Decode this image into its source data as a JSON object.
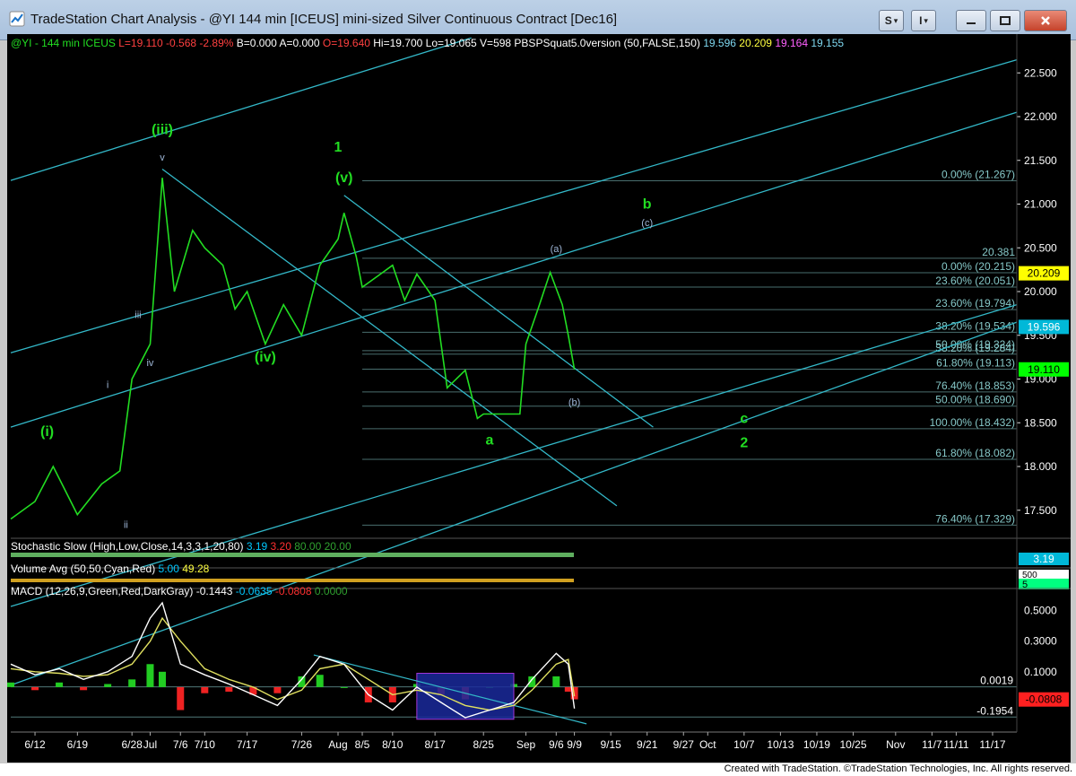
{
  "window": {
    "title": "TradeStation Chart Analysis - @YI 144 min [ICEUS] mini-sized Silver Continuous Contract [Dec16]",
    "btn_s": "S",
    "btn_i": "I",
    "btn_caret": "▾"
  },
  "footer": "Created with TradeStation. ©TradeStation Technologies, Inc. All rights reserved.",
  "colors": {
    "price": "#22dd22",
    "channel": "#33b8c8",
    "fib": "#86c8c8",
    "label_green": "#22dd22",
    "label_blue": "#9fb7d8"
  },
  "chart_data": {
    "type": "line",
    "title": "",
    "info_line": [
      {
        "text": "@YI - 144 min ICEUS",
        "color": "#22dd22"
      },
      {
        "text": "L=19.110 -0.568 -2.89%",
        "color": "#ff4040"
      },
      {
        "text": "B=0.000",
        "color": "#ffffff"
      },
      {
        "text": "A=0.000",
        "color": "#ffffff"
      },
      {
        "text": "O=19.640",
        "color": "#ff4040"
      },
      {
        "text": "Hi=19.700",
        "color": "#ffffff"
      },
      {
        "text": "Lo=19.065",
        "color": "#ffffff"
      },
      {
        "text": "V=598",
        "color": "#ffffff"
      },
      {
        "text": "PBSPSquat5.0version (50,FALSE,150)",
        "color": "#ffffff"
      },
      {
        "text": "19.596",
        "color": "#7fd8f0"
      },
      {
        "text": "20.209",
        "color": "#ffff40"
      },
      {
        "text": "19.164",
        "color": "#ff60ff"
      },
      {
        "text": "19.155",
        "color": "#7fd8f0"
      }
    ],
    "x_ticks": [
      "6/12",
      "6/19",
      "6/28",
      "Jul",
      "7/6",
      "7/10",
      "7/17",
      "7/26",
      "Aug",
      "8/5",
      "8/10",
      "8/17",
      "8/25",
      "Sep",
      "9/6",
      "9/9",
      "9/15",
      "9/21",
      "9/27",
      "Oct",
      "10/7",
      "10/13",
      "10/19",
      "10/25",
      "Nov",
      "11/7",
      "11/11",
      "11/17"
    ],
    "x_tick_dates": [
      "2016-06-12",
      "2016-06-19",
      "2016-06-28",
      "2016-07-01",
      "2016-07-06",
      "2016-07-10",
      "2016-07-17",
      "2016-07-26",
      "2016-08-01",
      "2016-08-05",
      "2016-08-10",
      "2016-08-17",
      "2016-08-25",
      "2016-09-01",
      "2016-09-06",
      "2016-09-09",
      "2016-09-15",
      "2016-09-21",
      "2016-09-27",
      "2016-10-01",
      "2016-10-07",
      "2016-10-13",
      "2016-10-19",
      "2016-10-25",
      "2016-11-01",
      "2016-11-07",
      "2016-11-11",
      "2016-11-17"
    ],
    "price_axis": {
      "range": [
        17.2,
        22.8
      ],
      "ticks": [
        "22.500",
        "22.000",
        "21.500",
        "21.000",
        "20.500",
        "20.000",
        "19.500",
        "19.000",
        "18.500",
        "18.000",
        "17.500"
      ]
    },
    "price_series": {
      "x": [
        "2016-06-08",
        "2016-06-12",
        "2016-06-15",
        "2016-06-19",
        "2016-06-23",
        "2016-06-26",
        "2016-06-28",
        "2016-07-01",
        "2016-07-03",
        "2016-07-05",
        "2016-07-08",
        "2016-07-10",
        "2016-07-13",
        "2016-07-15",
        "2016-07-17",
        "2016-07-20",
        "2016-07-23",
        "2016-07-26",
        "2016-07-29",
        "2016-08-01",
        "2016-08-02",
        "2016-08-04",
        "2016-08-05",
        "2016-08-08",
        "2016-08-10",
        "2016-08-12",
        "2016-08-14",
        "2016-08-17",
        "2016-08-19",
        "2016-08-22",
        "2016-08-24",
        "2016-08-25",
        "2016-08-28",
        "2016-08-31",
        "2016-09-01",
        "2016-09-03",
        "2016-09-05",
        "2016-09-07",
        "2016-09-08",
        "2016-09-09"
      ],
      "y": [
        17.4,
        17.6,
        18.0,
        17.45,
        17.8,
        17.95,
        19.0,
        19.4,
        21.3,
        20.0,
        20.7,
        20.5,
        20.3,
        19.8,
        20.0,
        19.4,
        19.85,
        19.5,
        20.3,
        20.6,
        20.9,
        20.4,
        20.05,
        20.2,
        20.3,
        19.9,
        20.2,
        19.9,
        18.9,
        19.1,
        18.55,
        18.6,
        18.6,
        18.6,
        19.4,
        19.8,
        20.22,
        19.85,
        19.5,
        19.11
      ]
    },
    "current_price": "19.110",
    "price_markers": [
      {
        "value": "20.209",
        "y": 20.209,
        "bg": "#ffff00",
        "fg": "#000000"
      },
      {
        "value": "19.596",
        "y": 19.596,
        "bg": "#00b8d8",
        "fg": "#ffffff"
      },
      {
        "value": "19.110",
        "y": 19.11,
        "bg": "#00ff00",
        "fg": "#000000"
      }
    ],
    "horizontal_levels": [
      {
        "label": "0.00% (21.267)",
        "y": 21.267
      },
      {
        "label": "20.381",
        "y": 20.381
      },
      {
        "label": "0.00% (20.215)",
        "y": 20.215
      },
      {
        "label": "23.60% (20.051)",
        "y": 20.051
      },
      {
        "label": "23.60% (19.794)",
        "y": 19.794
      },
      {
        "label": "38.20% (19.534)",
        "y": 19.534
      },
      {
        "label": "50.00% (19.324)",
        "y": 19.324
      },
      {
        "label": "38.20% (19.284)",
        "y": 19.284
      },
      {
        "label": "61.80% (19.113)",
        "y": 19.113
      },
      {
        "label": "76.40% (18.853)",
        "y": 18.853
      },
      {
        "label": "50.00% (18.690)",
        "y": 18.69
      },
      {
        "label": "100.00% (18.432)",
        "y": 18.432
      },
      {
        "label": "61.80% (18.082)",
        "y": 18.082
      },
      {
        "label": "76.40% (17.329)",
        "y": 17.329
      }
    ],
    "wave_labels": [
      {
        "text": "(iii)",
        "x": "2016-07-03",
        "y": 21.8,
        "color": "green",
        "size": "big"
      },
      {
        "text": "v",
        "x": "2016-07-03",
        "y": 21.5,
        "color": "blue",
        "size": "small"
      },
      {
        "text": "1",
        "x": "2016-08-01",
        "y": 21.6,
        "color": "green",
        "size": "big"
      },
      {
        "text": "(v)",
        "x": "2016-08-02",
        "y": 21.25,
        "color": "green",
        "size": "big"
      },
      {
        "text": "(iv)",
        "x": "2016-07-20",
        "y": 19.2,
        "color": "green",
        "size": "big"
      },
      {
        "text": "iii",
        "x": "2016-06-29",
        "y": 19.7,
        "color": "blue",
        "size": "small"
      },
      {
        "text": "iv",
        "x": "2016-07-01",
        "y": 19.15,
        "color": "blue",
        "size": "small"
      },
      {
        "text": "i",
        "x": "2016-06-24",
        "y": 18.9,
        "color": "blue",
        "size": "small"
      },
      {
        "text": "(i)",
        "x": "2016-06-14",
        "y": 18.35,
        "color": "green",
        "size": "big"
      },
      {
        "text": "ii",
        "x": "2016-06-27",
        "y": 17.3,
        "color": "blue",
        "size": "small"
      },
      {
        "text": "a",
        "x": "2016-08-26",
        "y": 18.25,
        "color": "green",
        "size": "big"
      },
      {
        "text": "(a)",
        "x": "2016-09-06",
        "y": 20.45,
        "color": "blue",
        "size": "small"
      },
      {
        "text": "(b)",
        "x": "2016-09-09",
        "y": 18.7,
        "color": "blue",
        "size": "small"
      },
      {
        "text": "b",
        "x": "2016-09-21",
        "y": 20.95,
        "color": "green",
        "size": "big"
      },
      {
        "text": "(c)",
        "x": "2016-09-21",
        "y": 20.75,
        "color": "blue",
        "size": "small"
      },
      {
        "text": "c",
        "x": "2016-10-07",
        "y": 18.5,
        "color": "green",
        "size": "big"
      },
      {
        "text": "2",
        "x": "2016-10-07",
        "y": 18.22,
        "color": "green",
        "size": "big"
      }
    ],
    "channel_lines": [
      {
        "x1": "2016-06-08",
        "y1": 21.27,
        "x2": "2016-08-23",
        "y2": 22.9
      },
      {
        "x1": "2016-06-08",
        "y1": 19.3,
        "x2": "2016-11-21",
        "y2": 22.65
      },
      {
        "x1": "2016-06-08",
        "y1": 18.45,
        "x2": "2016-11-21",
        "y2": 22.05
      },
      {
        "x1": "2016-06-08",
        "y1": 16.4,
        "x2": "2016-11-21",
        "y2": 19.85
      },
      {
        "x1": "2016-06-08",
        "y1": 15.5,
        "x2": "2016-11-21",
        "y2": 19.65
      },
      {
        "x1": "2016-07-03",
        "y1": 21.4,
        "x2": "2016-09-16",
        "y2": 17.55
      },
      {
        "x1": "2016-08-02",
        "y1": 21.1,
        "x2": "2016-09-22",
        "y2": 18.45
      }
    ],
    "panels": {
      "stochastic": {
        "title": "Stochastic Slow (High,Low,Close,14,3,3,1,20,80)",
        "values": [
          "3.19",
          "3.20",
          "80.00",
          "20.00"
        ],
        "colors": [
          "#00c8ff",
          "#ff3030",
          "#2fa02f",
          "#2fa02f"
        ],
        "marker": "3.19"
      },
      "volume": {
        "title": "Volume Avg (50,50,Cyan,Red)",
        "values": [
          "5.00",
          "49.28"
        ],
        "colors": [
          "#00c8ff",
          "#ffff40"
        ],
        "markers": [
          "500",
          "5"
        ]
      },
      "macd": {
        "title": "MACD (12,26,9,Green,Red,DarkGray)",
        "values": [
          "-0.1443",
          "-0.0635",
          "-0.0808",
          "0.0000"
        ],
        "colors": [
          "#ffffff",
          "#00c8ff",
          "#ff3030",
          "#2fa02f"
        ],
        "range": [
          -0.27,
          0.62
        ],
        "ticks": [
          "0.5000",
          "0.3000",
          "0.1000"
        ],
        "levels": [
          {
            "label": "0.0019",
            "y": 0.0019
          },
          {
            "label": "-0.1954",
            "y": -0.1954
          }
        ],
        "marker": "-0.0808",
        "x": [
          "2016-06-08",
          "2016-06-12",
          "2016-06-16",
          "2016-06-20",
          "2016-06-24",
          "2016-06-28",
          "2016-07-01",
          "2016-07-03",
          "2016-07-06",
          "2016-07-10",
          "2016-07-14",
          "2016-07-18",
          "2016-07-22",
          "2016-07-26",
          "2016-07-29",
          "2016-08-02",
          "2016-08-06",
          "2016-08-10",
          "2016-08-14",
          "2016-08-18",
          "2016-08-22",
          "2016-08-26",
          "2016-08-30",
          "2016-09-02",
          "2016-09-06",
          "2016-09-08",
          "2016-09-09"
        ],
        "macd": [
          0.15,
          0.08,
          0.12,
          0.05,
          0.1,
          0.2,
          0.45,
          0.55,
          0.15,
          0.08,
          0.02,
          -0.05,
          -0.12,
          0.05,
          0.2,
          0.15,
          -0.05,
          -0.15,
          0.0,
          -0.1,
          -0.2,
          -0.15,
          -0.1,
          0.05,
          0.22,
          0.15,
          -0.14
        ],
        "signal": [
          0.12,
          0.1,
          0.09,
          0.07,
          0.08,
          0.15,
          0.3,
          0.45,
          0.3,
          0.12,
          0.05,
          0.0,
          -0.08,
          -0.02,
          0.12,
          0.15,
          0.05,
          -0.05,
          -0.02,
          -0.05,
          -0.12,
          -0.15,
          -0.12,
          -0.02,
          0.15,
          0.18,
          -0.06
        ]
      }
    }
  }
}
